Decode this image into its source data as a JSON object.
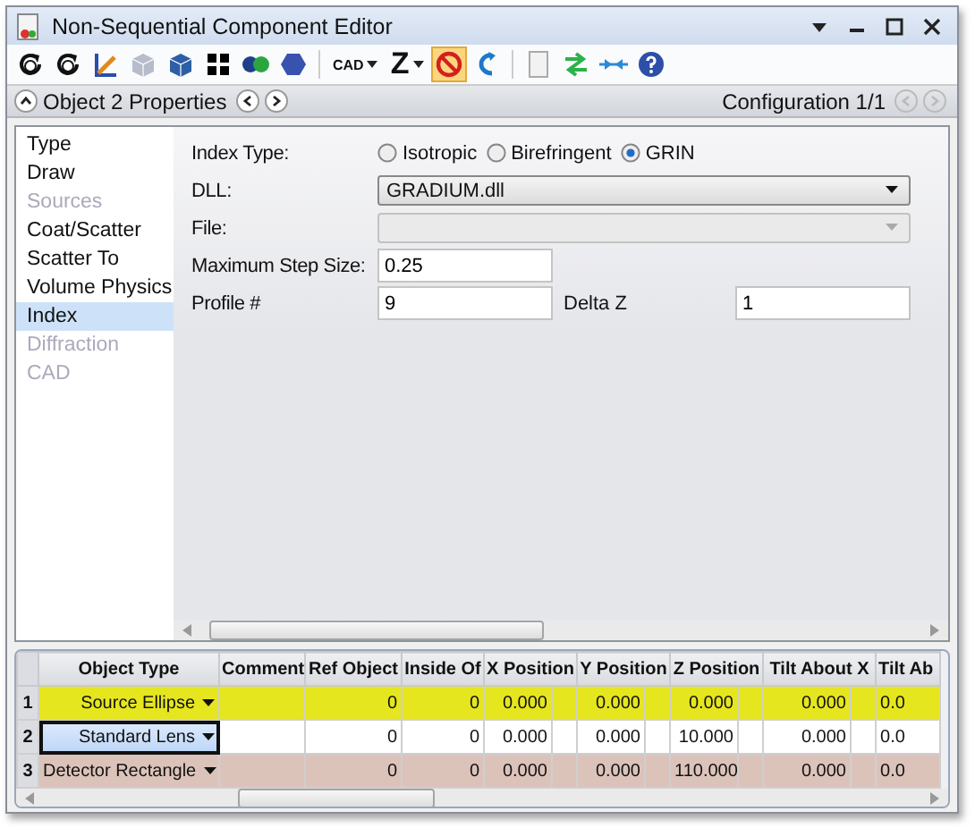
{
  "window": {
    "title": "Non-Sequential Component Editor"
  },
  "toolbar": [
    {
      "kind": "icon"
    },
    {
      "kind": "icon"
    },
    {
      "kind": "icon"
    },
    {
      "kind": "icon"
    },
    {
      "kind": "icon"
    },
    {
      "kind": "icon"
    },
    {
      "kind": "icon"
    },
    {
      "kind": "icon"
    },
    {
      "kind": "sep"
    },
    {
      "kind": "menu",
      "label": "CAD"
    },
    {
      "kind": "bigmenu",
      "label": "Z"
    },
    {
      "kind": "toggle",
      "on": true
    },
    {
      "kind": "icon"
    },
    {
      "kind": "sep"
    },
    {
      "kind": "icon"
    },
    {
      "kind": "icon"
    },
    {
      "kind": "icon"
    },
    {
      "kind": "icon"
    }
  ],
  "properties_bar": {
    "title": "Object 2 Properties",
    "configuration": "Configuration 1/1"
  },
  "sidebar": {
    "items": [
      {
        "label": "Type",
        "selected": false,
        "disabled": false
      },
      {
        "label": "Draw",
        "selected": false,
        "disabled": false
      },
      {
        "label": "Sources",
        "selected": false,
        "disabled": true
      },
      {
        "label": "Coat/Scatter",
        "selected": false,
        "disabled": false
      },
      {
        "label": "Scatter To",
        "selected": false,
        "disabled": false
      },
      {
        "label": "Volume Physics",
        "selected": false,
        "disabled": false
      },
      {
        "label": "Index",
        "selected": true,
        "disabled": false
      },
      {
        "label": "Diffraction",
        "selected": false,
        "disabled": true
      },
      {
        "label": "CAD",
        "selected": false,
        "disabled": true
      }
    ]
  },
  "index_form": {
    "index_type_label": "Index Type:",
    "index_types": [
      {
        "label": "Isotropic",
        "selected": false
      },
      {
        "label": "Birefringent",
        "selected": false
      },
      {
        "label": "GRIN",
        "selected": true
      }
    ],
    "dll_label": "DLL:",
    "dll_value": "GRADIUM.dll",
    "file_label": "File:",
    "file_disabled": true,
    "max_step_label": "Maximum Step Size:",
    "max_step_value": "0.25",
    "profile_label": "Profile #",
    "profile_value": "9",
    "delta_z_label": "Delta Z",
    "delta_z_value": "1"
  },
  "table": {
    "columns": [
      {
        "label": "Object Type",
        "kind": "type"
      },
      {
        "label": "Comment",
        "kind": "plain"
      },
      {
        "label": "Ref Object",
        "kind": "plain"
      },
      {
        "label": "Inside Of",
        "kind": "plain"
      },
      {
        "label": "X Position",
        "kind": "solve"
      },
      {
        "label": "Y Position",
        "kind": "solve"
      },
      {
        "label": "Z Position",
        "kind": "solve"
      },
      {
        "label": "Tilt About X",
        "kind": "solve"
      },
      {
        "label": "Tilt Ab",
        "kind": "cut"
      }
    ],
    "rows": [
      {
        "number": "1",
        "color": "#e6e61e",
        "selected": false,
        "cells": [
          "Source Ellipse",
          "",
          "0",
          "0",
          "0.000",
          "0.000",
          "0.000",
          "0.000",
          "0.0"
        ]
      },
      {
        "number": "2",
        "color": "#ffffff",
        "selected": true,
        "cells": [
          "Standard Lens",
          "",
          "0",
          "0",
          "0.000",
          "0.000",
          "10.000",
          "0.000",
          "0.0"
        ]
      },
      {
        "number": "3",
        "color": "#dcc3ba",
        "selected": false,
        "cells": [
          "Detector Rectangle",
          "",
          "0",
          "0",
          "0.000",
          "0.000",
          "110.000",
          "0.000",
          "0.0"
        ]
      }
    ]
  }
}
